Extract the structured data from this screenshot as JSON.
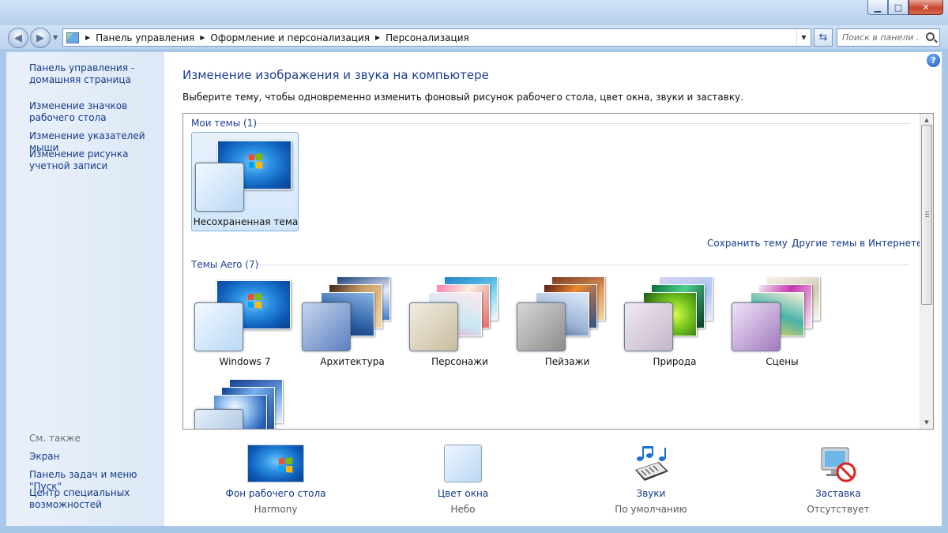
{
  "window": {
    "minimize_glyph": "▁",
    "maximize_glyph": "□",
    "close_glyph": "✕"
  },
  "navigation": {
    "breadcrumbs": [
      "Панель управления",
      "Оформление и персонализация",
      "Персонализация"
    ],
    "search_placeholder": "Поиск в панели ..."
  },
  "sidebar": {
    "links": [
      "Панель управления - домашняя страница",
      "Изменение значков рабочего стола",
      "Изменение указателей мыши",
      "Изменение рисунка учетной записи"
    ],
    "see_also_label": "См. также",
    "see_also": [
      "Экран",
      "Панель задач и меню \"Пуск\"",
      "Центр специальных возможностей"
    ]
  },
  "main": {
    "title": "Изменение изображения и звука на компьютере",
    "description": "Выберите тему, чтобы одновременно изменить фоновый рисунок рабочего стола, цвет окна, звуки и заставку.",
    "my_themes_header": "Мои темы (1)",
    "my_themes": [
      {
        "label": "Несохраненная тема",
        "selected": true
      }
    ],
    "save_theme_link": "Сохранить тему",
    "more_themes_link": "Другие темы в Интернете",
    "aero_header": "Темы Aero (7)",
    "aero_themes": [
      "Windows 7",
      "Архитектура",
      "Персонажи",
      "Пейзажи",
      "Природа",
      "Сцены"
    ]
  },
  "bottom": {
    "desktop_background": {
      "label": "Фон рабочего стола",
      "value": "Harmony",
      "icon": "wallpaper-icon"
    },
    "window_color": {
      "label": "Цвет окна",
      "value": "Небо",
      "icon": "color-swatch-icon"
    },
    "sounds": {
      "label": "Звуки",
      "value": "По умолчанию",
      "icon": "music-notes-icon"
    },
    "screensaver": {
      "label": "Заставка",
      "value": "Отсутствует",
      "icon": "no-screensaver-icon"
    }
  },
  "colors": {
    "link": "#133b86",
    "title": "#1e3f8f",
    "selection": "#d2e6fb"
  }
}
